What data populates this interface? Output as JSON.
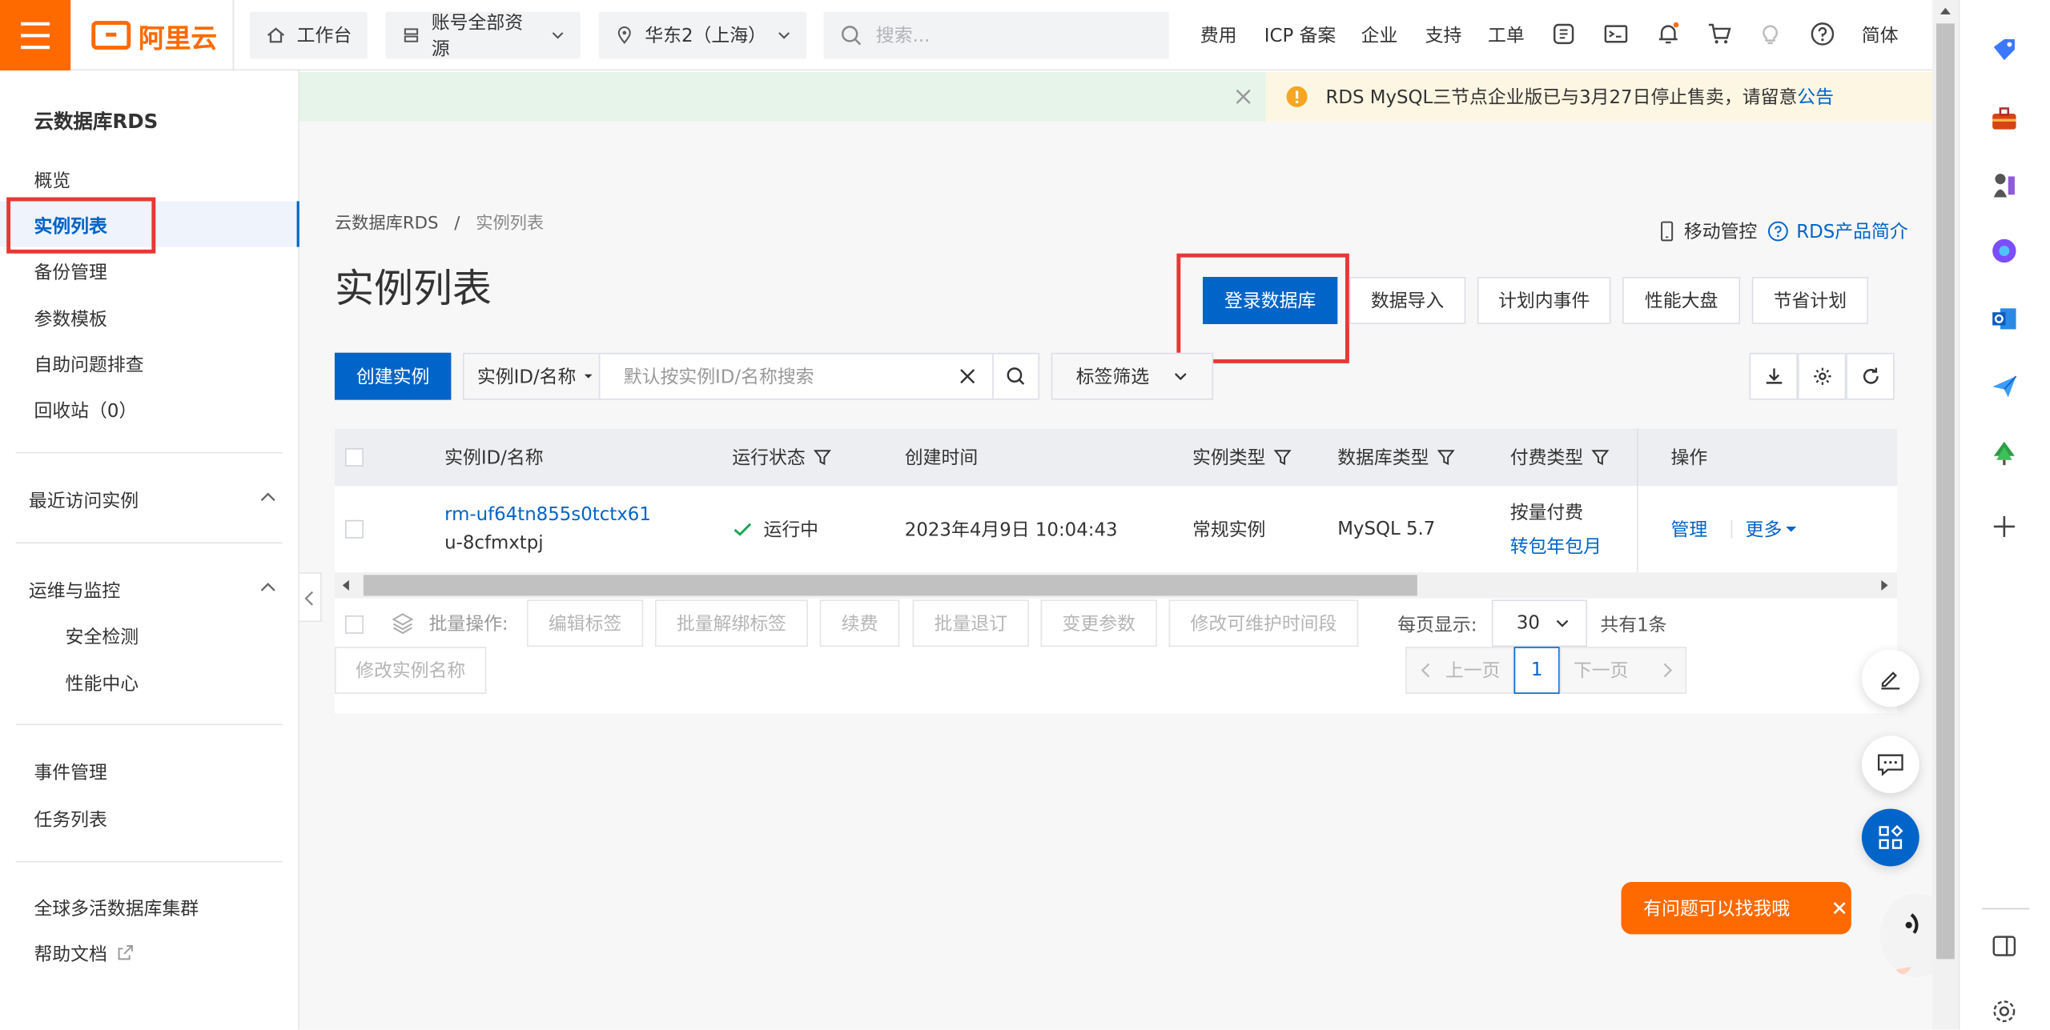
{
  "topbar": {
    "logo_text": "阿里云",
    "workbench": "工作台",
    "resources": "账号全部资源",
    "region": "华东2（上海）",
    "search_placeholder": "搜索...",
    "links": [
      "费用",
      "ICP 备案",
      "企业",
      "支持",
      "工单"
    ],
    "lang": "简体"
  },
  "sidebar": {
    "title": "云数据库RDS",
    "items": [
      "概览",
      "实例列表",
      "备份管理",
      "参数模板",
      "自助问题排查",
      "回收站（0）"
    ],
    "recent_group": "最近访问实例",
    "ops_group": "运维与监控",
    "ops_items": [
      "安全检测",
      "性能中心"
    ],
    "bottom_items": [
      "事件管理",
      "任务列表"
    ],
    "global_items": [
      "全球多活数据库集群",
      "帮助文档"
    ]
  },
  "notice": {
    "text": "RDS MySQL三节点企业版已与3月27日停止售卖，请留意",
    "link": "公告"
  },
  "breadcrumb": {
    "root": "云数据库RDS",
    "sep": "/",
    "current": "实例列表"
  },
  "page": {
    "title": "实例列表",
    "mobile_control": "移动管控",
    "rds_intro": "RDS产品简介"
  },
  "actions": {
    "login_db": "登录数据库",
    "data_import": "数据导入",
    "planned_events": "计划内事件",
    "perf_dashboard": "性能大盘",
    "savings_plan": "节省计划",
    "create_instance": "创建实例"
  },
  "search": {
    "select_label": "实例ID/名称",
    "placeholder": "默认按实例ID/名称搜索",
    "tag_filter": "标签筛选"
  },
  "table": {
    "columns": [
      "实例ID/名称",
      "运行状态",
      "创建时间",
      "实例类型",
      "数据库类型",
      "付费类型",
      "操作"
    ],
    "rows": [
      {
        "id": "rm-uf64tn855s0tctx61",
        "name": "u-8cfmxtpj",
        "status": "运行中",
        "created": "2023年4月9日 10:04:43",
        "instance_type": "常规实例",
        "db_type": "MySQL 5.7",
        "pay_type": "按量付费",
        "pay_link": "转包年包月",
        "op_manage": "管理",
        "op_more": "更多"
      }
    ]
  },
  "batch": {
    "label": "批量操作:",
    "buttons": [
      "编辑标签",
      "批量解绑标签",
      "续费",
      "批量退订",
      "变更参数",
      "修改可维护时间段"
    ],
    "rename": "修改实例名称"
  },
  "pagination": {
    "per_page_label": "每页显示:",
    "per_page": "30",
    "total": "共有1条",
    "prev": "上一页",
    "current": "1",
    "next": "下一页"
  },
  "assistant": {
    "text": "有问题可以找我哦"
  },
  "colors": {
    "brand": "#ff6a00",
    "primary": "#0064c8",
    "highlight": "#e53935",
    "success": "#1aa653"
  }
}
